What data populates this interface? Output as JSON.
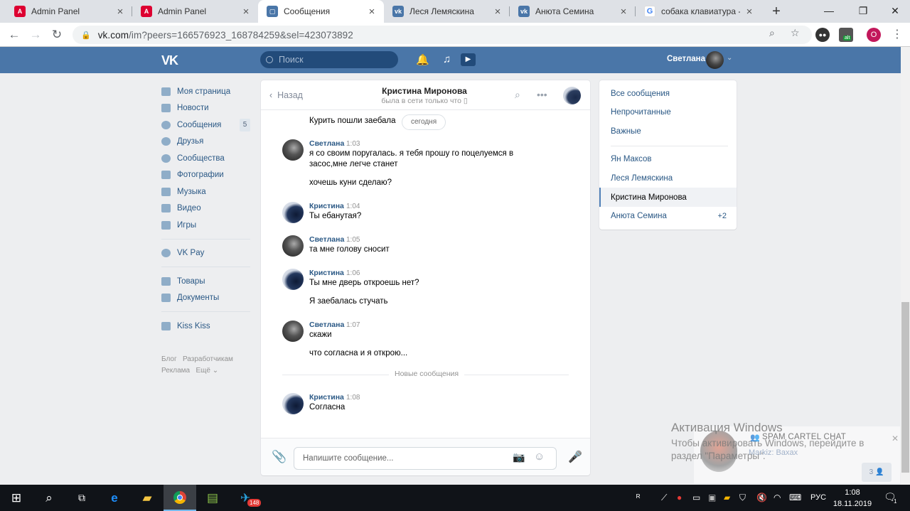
{
  "browser": {
    "tabs": [
      {
        "title": "Admin Panel",
        "icon": "angular-icon",
        "color": "#dd0031"
      },
      {
        "title": "Admin Panel",
        "icon": "angular-icon",
        "color": "#dd0031"
      },
      {
        "title": "Сообщения",
        "icon": "vk-messages-icon",
        "color": "#4a76a8"
      },
      {
        "title": "Леся Лемяскина",
        "icon": "vk-icon",
        "color": "#4a76a8"
      },
      {
        "title": "Анюта Семина",
        "icon": "vk-icon",
        "color": "#4a76a8"
      },
      {
        "title": "собака клавиатура - П",
        "icon": "google-icon",
        "color": "#4285f4"
      }
    ],
    "active_tab": 2,
    "url_host": "vk.com",
    "url_rest": "/im?peers=166576923_168784259&sel=423073892",
    "profile_letter": "O",
    "extension_badge": "alt"
  },
  "vk": {
    "logo": "VK",
    "search_placeholder": "Поиск",
    "user_name": "Светлана",
    "sidebar": [
      {
        "label": "Моя страница",
        "icon": "home-icon"
      },
      {
        "label": "Новости",
        "icon": "news-icon"
      },
      {
        "label": "Сообщения",
        "icon": "messages-icon",
        "badge": "5"
      },
      {
        "label": "Друзья",
        "icon": "friends-icon"
      },
      {
        "label": "Сообщества",
        "icon": "groups-icon"
      },
      {
        "label": "Фотографии",
        "icon": "camera-icon"
      },
      {
        "label": "Музыка",
        "icon": "music-icon"
      },
      {
        "label": "Видео",
        "icon": "video-icon"
      },
      {
        "label": "Игры",
        "icon": "gamepad-icon"
      },
      {
        "label": "VK Pay",
        "icon": "vkpay-icon"
      },
      {
        "label": "Товары",
        "icon": "bag-icon"
      },
      {
        "label": "Документы",
        "icon": "document-icon"
      },
      {
        "label": "Kiss Kiss",
        "icon": "apps-icon"
      }
    ],
    "footer": {
      "blog": "Блог",
      "dev": "Разработчикам",
      "ads": "Реклама",
      "more": "Ещё"
    },
    "chat": {
      "back": "Назад",
      "title": "Кристина Миронова",
      "status": "была в сети только что",
      "date_chip": "сегодня",
      "prev_text": "Курить пошли заебала",
      "messages": [
        {
          "author": "Светлана",
          "time": "1:03",
          "lines": [
            "я со своим поругалась. я тебя прошу го поцелуемся в засос,мне легче станет",
            "хочешь куни сделаю?"
          ]
        },
        {
          "author": "Кристина",
          "time": "1:04",
          "lines": [
            "Ты ебанутая?"
          ]
        },
        {
          "author": "Светлана",
          "time": "1:05",
          "lines": [
            "та мне голову сносит"
          ]
        },
        {
          "author": "Кристина",
          "time": "1:06",
          "lines": [
            "Ты мне дверь откроешь нет?",
            "Я заебалась стучать"
          ]
        },
        {
          "author": "Светлана",
          "time": "1:07",
          "lines": [
            "скажи",
            "что согласна и я открою..."
          ]
        },
        {
          "author": "Кристина",
          "time": "1:08",
          "lines": [
            "Согласна"
          ]
        }
      ],
      "new_messages_label": "Новые сообщения",
      "composer_placeholder": "Напишите сообщение..."
    },
    "filters": {
      "all": "Все сообщения",
      "unread": "Непрочитанные",
      "important": "Важные",
      "dialogs": [
        {
          "name": "Ян Максов"
        },
        {
          "name": "Леся Лемяскина"
        },
        {
          "name": "Кристина Миронова",
          "selected": true
        },
        {
          "name": "Анюта Семина",
          "count": "+2"
        }
      ]
    }
  },
  "overlay": {
    "activation_title": "Активация Windows",
    "activation_text": "Чтобы активировать Windows, перейдите в раздел \"Параметры\".",
    "popup_title": "SPAM CARTEL CHAT",
    "popup_sub": "Markiz: Baxax",
    "popup_count": "3"
  },
  "taskbar": {
    "telegram_badge": "148",
    "lang": "РУС",
    "time": "1:08",
    "date": "18.11.2019",
    "notifications": "1"
  }
}
